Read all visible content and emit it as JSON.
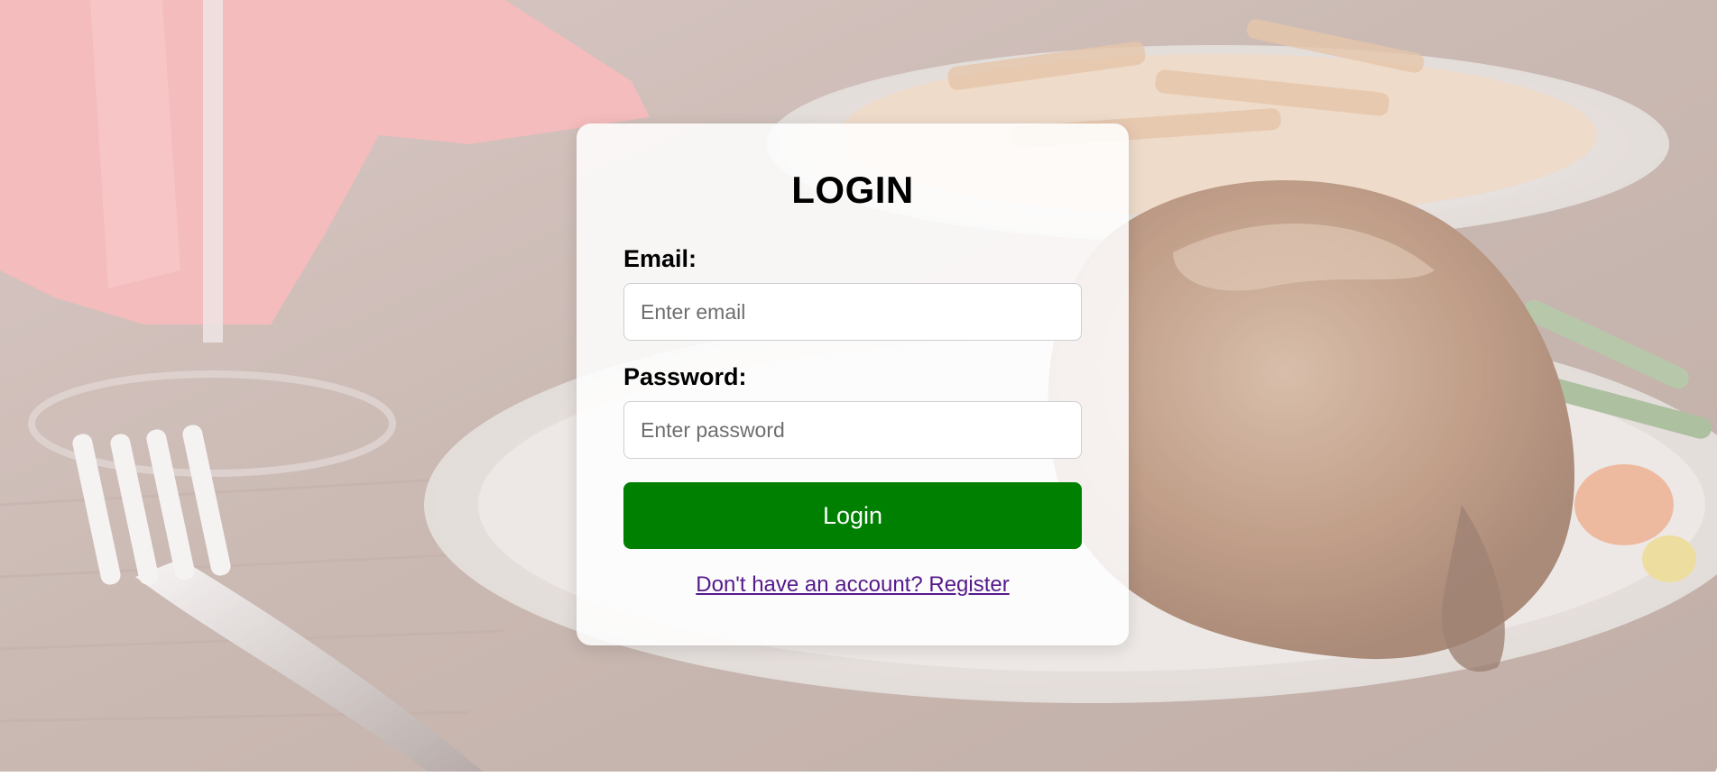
{
  "login": {
    "title": "LOGIN",
    "email_label": "Email:",
    "email_value": "",
    "email_placeholder": "Enter email",
    "password_label": "Password:",
    "password_value": "",
    "password_placeholder": "Enter password",
    "submit_label": "Login",
    "register_link": "Don't have an account? Register"
  },
  "colors": {
    "button_bg": "#008000",
    "button_text": "#ffffff",
    "link": "#551a8b",
    "card_bg": "#ffffff"
  },
  "background": {
    "description_icon": "food-photo"
  }
}
